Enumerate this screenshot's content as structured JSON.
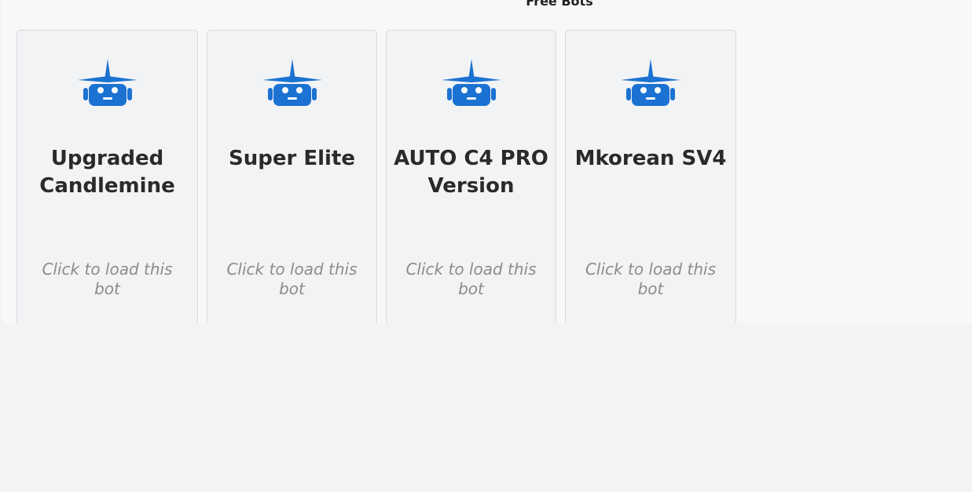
{
  "section": {
    "title": "Free Bots"
  },
  "bots": [
    {
      "name": "Upgraded Candlemine",
      "hint": "Click to load this bot",
      "icon": "robot-icon"
    },
    {
      "name": "Super Elite",
      "hint": "Click to load this bot",
      "icon": "robot-icon"
    },
    {
      "name": "AUTO C4 PRO Version",
      "hint": "Click to load this bot",
      "icon": "robot-icon"
    },
    {
      "name": "Mkorean SV4",
      "hint": "Click to load this bot",
      "icon": "robot-icon"
    }
  ],
  "colors": {
    "icon": "#1b72d2",
    "card_background": "#f2f3f5",
    "card_border": "#d9d9dc",
    "title_text": "#2a2a2a",
    "hint_text": "#8c8c8c"
  }
}
